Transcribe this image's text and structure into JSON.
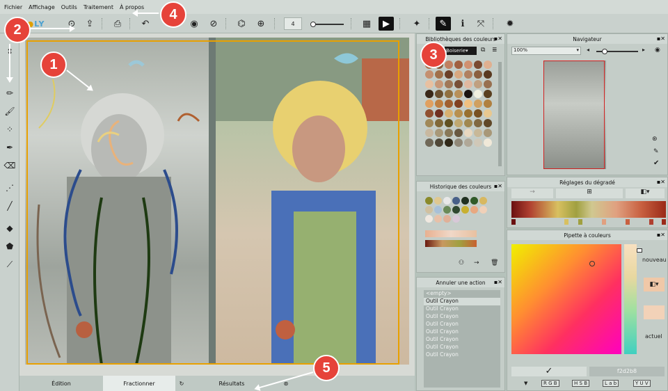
{
  "menubar": [
    "Fichier",
    "Affichage",
    "Outils",
    "Traitement",
    "À propos"
  ],
  "toolbar": {
    "brush_size": "4"
  },
  "bottom_tabs": {
    "edition": "Édition",
    "fractionner": "Fractionner",
    "resultats": "Résultats"
  },
  "panels": {
    "bibliotheques": {
      "title": "Bibliothèques des couleurs",
      "selected": "Boiserie"
    },
    "historique": {
      "title": "Historique des couleurs"
    },
    "annuler": {
      "title": "Annuler une action",
      "items": [
        "<empty>",
        "Outil Crayon",
        "Outil Crayon",
        "Outil Crayon",
        "Outil Crayon",
        "Outil Crayon",
        "Outil Crayon",
        "Outil Crayon",
        "Outil Crayon"
      ]
    },
    "navigateur": {
      "title": "Navigateur",
      "zoom": "100%"
    },
    "degrade": {
      "title": "Réglages du dégradé"
    },
    "pipette": {
      "title": "Pipette à couleurs",
      "nouveau": "nouveau",
      "actuel": "actuel",
      "hex": "f2d2b8"
    }
  },
  "color_modes": [
    "R",
    "G",
    "B",
    "H",
    "S",
    "B",
    "L",
    "a",
    "b",
    "Y",
    "U",
    "V"
  ],
  "annotations": [
    "1",
    "2",
    "3",
    "4",
    "5"
  ],
  "colors": {
    "accent": "#e8a000",
    "badge": "#e6433a",
    "library_swatches": [
      "#b07050",
      "#8a5a3a",
      "#c08060",
      "#a06040",
      "#d09070",
      "#7a4a30",
      "#e0b090",
      "#c49070",
      "#a0704a",
      "#6a4028",
      "#d8a880",
      "#b08060",
      "#8a6040",
      "#5a3a20",
      "#e8c0a0",
      "#c89878",
      "#a07858",
      "#785038",
      "#e0b8a0",
      "#c0a080",
      "#987050",
      "#3a2818",
      "#6a5030",
      "#907040",
      "#b89058",
      "#1a1410",
      "#f0f0e0",
      "#5a4020",
      "#e0a060",
      "#c08040",
      "#a06030",
      "#804020",
      "#f0c080",
      "#d0a060",
      "#b08040",
      "#905030",
      "#703020",
      "#d8b070",
      "#b89050",
      "#987030",
      "#785020",
      "#e8c890",
      "#a08858",
      "#806838",
      "#605020",
      "#c0a870",
      "#a08850",
      "#806840",
      "#604828",
      "#c8b8a0",
      "#a89878",
      "#887858",
      "#685840",
      "#e8d8c0",
      "#c8b898",
      "#a89878",
      "#706858",
      "#504838",
      "#302818",
      "#908878",
      "#b0a898",
      "#d0c8b8",
      "#f0e8d8"
    ],
    "history_swatches": [
      "#8a8a2a",
      "#e0c890",
      "#e8e8e8",
      "#486088",
      "#203020",
      "#305a28",
      "#d8b860",
      "#d0c0a0",
      "#a8c0d8",
      "#6a8a58",
      "#304830",
      "#c8b030",
      "#e8a880",
      "#f0d0b8",
      "#f0e8e0",
      "#e8c0a8",
      "#e0b098",
      "#d8c8d8"
    ]
  }
}
